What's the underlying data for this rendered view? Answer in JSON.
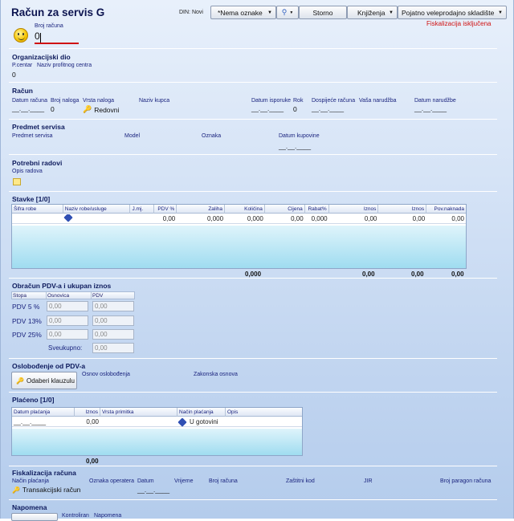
{
  "title": "Račun za servis G",
  "doc_status_label": "DIN: Novi",
  "toolbar": {
    "tag_select": "*Nema oznake",
    "storno": "Storno",
    "knjizenja": "Knjiženja",
    "warehouse": "Pojatno veleprodajno skladište"
  },
  "fiskal_status": "Fiskalizacija isključena",
  "broj_racuna": {
    "label": "Broj računa",
    "value": "0"
  },
  "org": {
    "title": "Organizacijski dio",
    "pcentar_label": "P.centar",
    "naziv_label": "Naziv profitnog centra",
    "pcentar_value": "0"
  },
  "racun": {
    "title": "Račun",
    "datum_racuna_label": "Datum računa",
    "datum_racuna_value": "__.__.____",
    "broj_naloga_label": "Broj naloga",
    "broj_naloga_value": "0",
    "vrsta_naloga_label": "Vrsta naloga",
    "vrsta_naloga_value": "Redovni",
    "naziv_kupca_label": "Naziv kupca",
    "datum_isporuke_label": "Datum isporuke",
    "datum_isporuke_value": "__.__.____",
    "rok_label": "Rok",
    "rok_value": "0",
    "dospijece_label": "Dospijeće računa",
    "dospijece_value": "__.__.____",
    "narudzba_label": "Vaša narudžba",
    "datum_narudzbe_label": "Datum narudžbe",
    "datum_narudzbe_value": "__.__.____"
  },
  "predmet": {
    "title": "Predmet servisa",
    "predmet_label": "Predmet servisa",
    "model_label": "Model",
    "oznaka_label": "Oznaka",
    "datum_kupovine_label": "Datum kupovine",
    "datum_kupovine_value": "__.__.____"
  },
  "radovi": {
    "title": "Potrebni radovi",
    "opis_label": "Opis radova"
  },
  "stavke": {
    "title": "Stavke   [1/0]",
    "columns": [
      "Šifra robe",
      "Naziv robe/usluge",
      "J.mj.",
      "PDV %",
      "Zaliha",
      "Količina",
      "Cijena",
      "Rabat%",
      "Iznos",
      "Iznos",
      "Pov.naknada"
    ],
    "row": [
      "",
      "",
      "",
      "0,00",
      "0,000",
      "0,000",
      "0,00",
      "0,000",
      "0,00",
      "0,00",
      "0,00"
    ],
    "totals": {
      "kolicina": "0,000",
      "iznos1": "0,00",
      "iznos2": "0,00",
      "pov": "0,00"
    }
  },
  "pdv": {
    "title": "Obračun PDV-a i ukupan iznos",
    "col_stopa": "Stopa",
    "col_osnovica": "Osnovica",
    "col_pdv": "PDV",
    "rows": [
      {
        "stopa": "PDV 5 %",
        "osnovica": "0,00",
        "pdv": "0,00"
      },
      {
        "stopa": "PDV 13%",
        "osnovica": "0,00",
        "pdv": "0,00"
      },
      {
        "stopa": "PDV 25%",
        "osnovica": "0,00",
        "pdv": "0,00"
      }
    ],
    "sveukupno_label": "Sveukupno:",
    "sveukupno_value": "0,00"
  },
  "oslobodjenje": {
    "title": "Oslobođenje od PDV-a",
    "button": "Odaberi klauzulu",
    "osnov_label": "Osnov oslobođenja",
    "zakonska_label": "Zakonska osnova"
  },
  "placeno": {
    "title": "Plaćeno   [1/0]",
    "columns": [
      "Datum plaćanja",
      "Iznos",
      "Vrsta primitka",
      "Način plaćanja",
      "Opis"
    ],
    "row": {
      "datum": "__.__.____",
      "iznos": "0,00",
      "vrsta": "",
      "nacin": "U gotovini",
      "opis": ""
    },
    "total": "0,00"
  },
  "fiskalizacija": {
    "title": "Fiskalizacija računa",
    "nacin_label": "Način plaćanja",
    "nacin_value": "Transakcijski račun",
    "operater_label": "Oznaka operatera",
    "datum_label": "Datum",
    "datum_value": "__.__.____",
    "vrijeme_label": "Vrijeme",
    "broj_label": "Broj računa",
    "zastitni_label": "Zaštitni kod",
    "jir_label": "JIR",
    "paragon_label": "Broj paragon računa"
  },
  "napomena": {
    "title": "Napomena",
    "kontroliran_label": "Kontroliran",
    "napomena_label": "Napomena"
  }
}
